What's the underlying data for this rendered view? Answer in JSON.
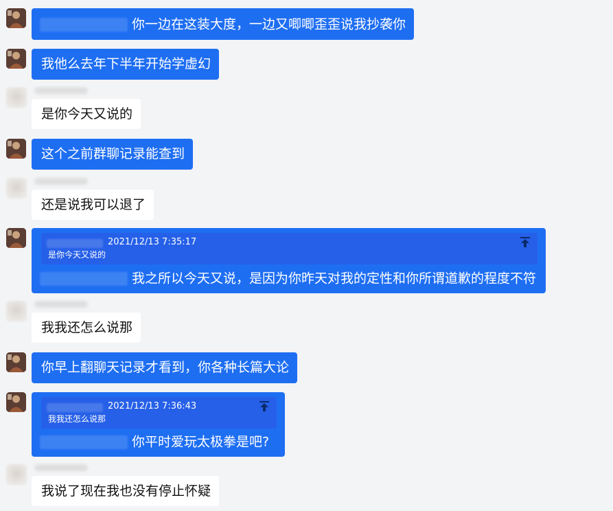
{
  "messages": [
    {
      "side": "me",
      "mention": true,
      "text": "你一边在这装大度，一边又唧唧歪歪说我抄袭你"
    },
    {
      "side": "me",
      "mention": false,
      "text": "我他么去年下半年开始学虚幻"
    },
    {
      "side": "other",
      "text": "是你今天又说的"
    },
    {
      "side": "me",
      "mention": false,
      "text": "这个之前群聊记录能查到"
    },
    {
      "side": "other",
      "text": "还是说我可以退了"
    },
    {
      "side": "me",
      "mention": true,
      "text": "我之所以今天又说，是因为你昨天对我的定性和你所谓道歉的程度不符",
      "quote": {
        "time": "2021/12/13 7:35:17",
        "text": "是你今天又说的"
      }
    },
    {
      "side": "other",
      "text": "我我还怎么说那"
    },
    {
      "side": "me",
      "mention": false,
      "text": "你早上翻聊天记录才看到，你各种长篇大论"
    },
    {
      "side": "me",
      "mention": true,
      "text": "你平时爱玩太极拳是吧?",
      "quote": {
        "time": "2021/12/13 7:36:43",
        "text": "我我还怎么说那"
      }
    },
    {
      "side": "other",
      "text": "我说了现在我也没有停止怀疑"
    }
  ],
  "colors": {
    "background": "#f3f4f6",
    "my_bubble": "#1e6ef2",
    "quote_block": "#2660e8",
    "other_bubble": "#ffffff"
  },
  "icons": {
    "avatar_me": "user-avatar-icon",
    "avatar_other": "contact-avatar-icon",
    "jump": "jump-to-message-icon"
  }
}
